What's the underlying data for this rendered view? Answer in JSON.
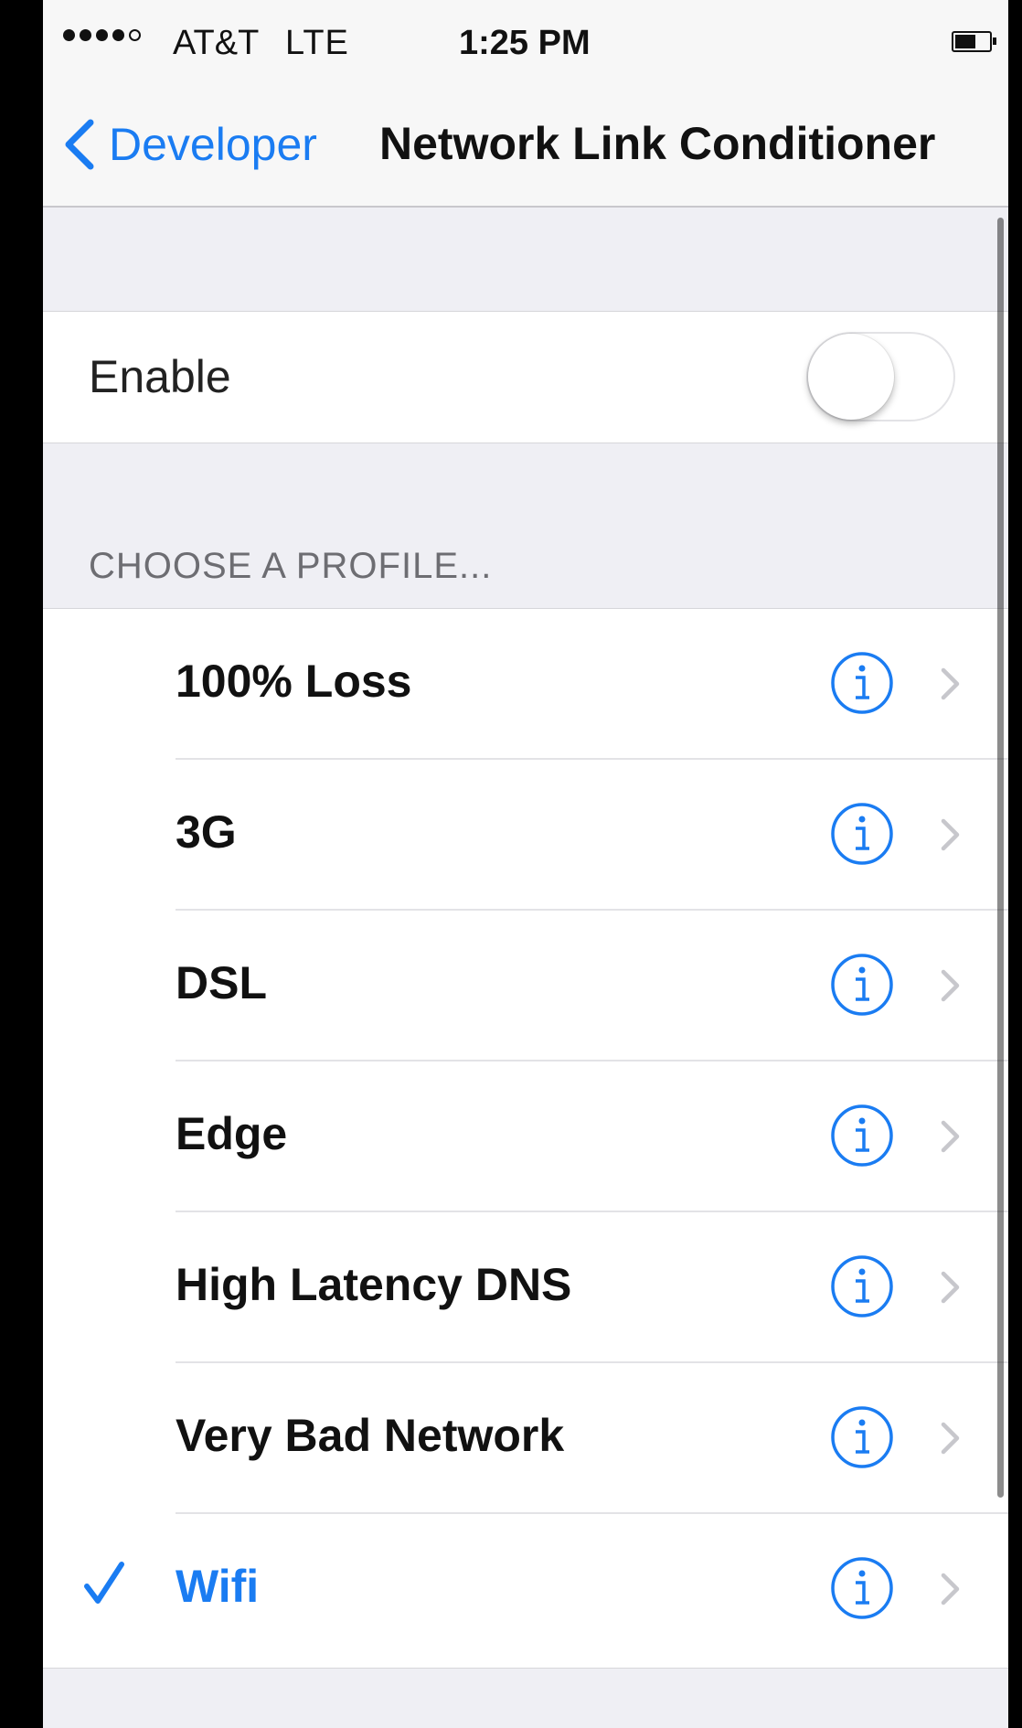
{
  "status_bar": {
    "carrier": "AT&T",
    "network": "LTE",
    "time": "1:25 PM",
    "signal_bars_filled": 4,
    "signal_bars_total": 5,
    "battery_level": 0.6
  },
  "nav": {
    "back_label": "Developer",
    "title": "Network Link Conditioner"
  },
  "enable": {
    "label": "Enable",
    "on": false
  },
  "profiles": {
    "header": "CHOOSE A PROFILE...",
    "items": [
      {
        "label": "100% Loss",
        "selected": false
      },
      {
        "label": "3G",
        "selected": false
      },
      {
        "label": "DSL",
        "selected": false
      },
      {
        "label": "Edge",
        "selected": false
      },
      {
        "label": "High Latency DNS",
        "selected": false
      },
      {
        "label": "Very Bad Network",
        "selected": false
      },
      {
        "label": "Wifi",
        "selected": true
      }
    ]
  },
  "colors": {
    "accent": "#1a7cf2",
    "grouped_background": "#efeff4",
    "secondary_text": "#6d6d72"
  },
  "icons": {
    "back": "chevron-left-icon",
    "info": "info-circle-icon",
    "disclosure": "chevron-right-icon",
    "check": "checkmark-icon"
  }
}
